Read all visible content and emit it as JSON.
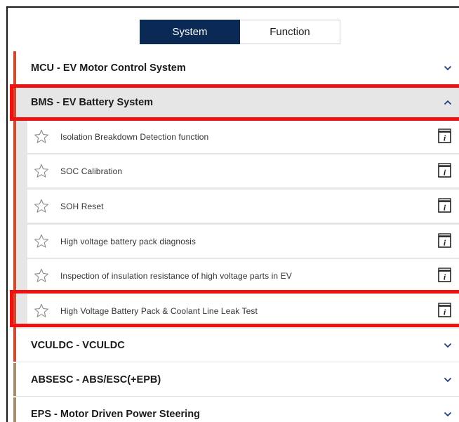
{
  "tabs": {
    "system": "System",
    "function": "Function"
  },
  "systems": [
    {
      "id": "mcu",
      "title": "MCU - EV Motor Control System",
      "expanded": false,
      "accent": "#d9472b"
    },
    {
      "id": "bms",
      "title": "BMS - EV Battery System",
      "expanded": true,
      "accent": "#d9472b"
    },
    {
      "id": "vculdc",
      "title": "VCULDC - VCULDC",
      "expanded": false,
      "accent": "#d9472b"
    },
    {
      "id": "absesc",
      "title": "ABSESC - ABS/ESC(+EPB)",
      "expanded": false,
      "accent": "#a58e6a"
    },
    {
      "id": "eps",
      "title": "EPS - Motor Driven Power Steering",
      "expanded": false,
      "accent": "#a58e6a"
    }
  ],
  "bms_functions": [
    {
      "label": "Isolation Breakdown Detection function",
      "icons": [
        "star-icon",
        "info-manual-icon"
      ]
    },
    {
      "label": "SOC Calibration",
      "icons": [
        "star-icon",
        "info-manual-icon"
      ]
    },
    {
      "label": "SOH Reset",
      "icons": [
        "star-icon",
        "info-manual-icon"
      ]
    },
    {
      "label": "High voltage battery pack diagnosis",
      "icons": [
        "star-icon",
        "info-manual-icon"
      ]
    },
    {
      "label": "Inspection of insulation resistance of high voltage parts in EV",
      "icons": [
        "star-icon",
        "info-manual-icon"
      ]
    },
    {
      "label": "High Voltage Battery Pack & Coolant Line Leak Test",
      "icons": [
        "star-icon",
        "info-manual-icon"
      ]
    }
  ],
  "colors": {
    "tab_active": "#0a2a55",
    "highlight": "#ee1111",
    "expanded_bg": "#e6e6e6",
    "chevron": "#1d3f7a"
  }
}
